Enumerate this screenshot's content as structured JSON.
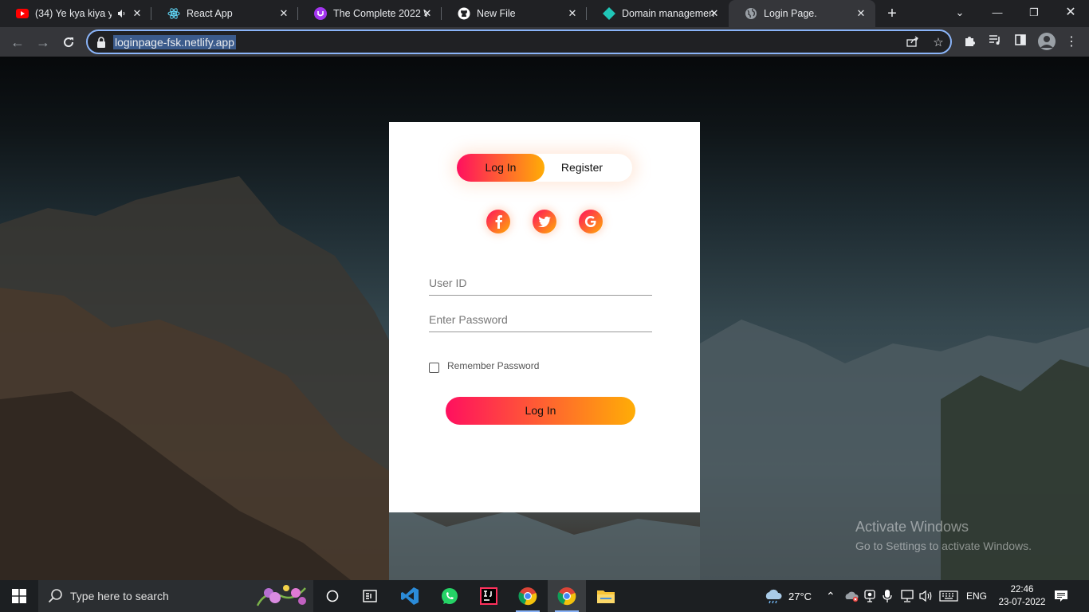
{
  "browser": {
    "tabs": [
      {
        "title": "(34) Ye kya kiya ye",
        "icon": "youtube-icon",
        "audio": true
      },
      {
        "title": "React App",
        "icon": "react-icon"
      },
      {
        "title": "The Complete 2022 W",
        "icon": "udemy-icon"
      },
      {
        "title": "New File",
        "icon": "github-icon"
      },
      {
        "title": "Domain management",
        "icon": "netlify-icon"
      },
      {
        "title": "Login Page.",
        "icon": "globe-icon",
        "active": true
      }
    ],
    "address": "loginpage-fsk.netlify.app"
  },
  "login": {
    "toggle_login": "Log In",
    "toggle_register": "Register",
    "social": [
      "facebook-icon",
      "twitter-icon",
      "google-icon"
    ],
    "user_placeholder": "User ID",
    "password_placeholder": "Enter Password",
    "remember_label": "Remember Password",
    "submit_label": "Log In",
    "colors": {
      "gradient_start": "#ff105f",
      "gradient_end": "#ffad06"
    }
  },
  "watermark": {
    "title": "Activate Windows",
    "subtitle": "Go to Settings to activate Windows."
  },
  "taskbar": {
    "search_placeholder": "Type here to search",
    "weather": "27°C",
    "language": "ENG",
    "time": "22:46",
    "date": "23-07-2022"
  }
}
